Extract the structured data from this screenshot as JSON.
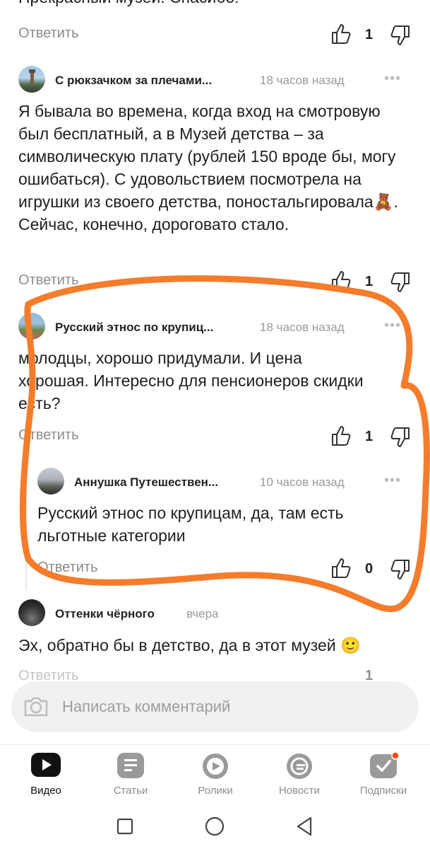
{
  "top_comment": {
    "text_tail": "Прекрасный музей. Спасибо!",
    "reply_label": "Ответить",
    "likes": "1"
  },
  "comments": [
    {
      "author": "С рюкзачком за плечами...",
      "time": "18 часов назад",
      "text": "Я бывала во времена, когда вход на смотровую был бесплатный, а в Музей детства – за символическую плату (рублей 150 вроде бы, могу ошибаться). С удовольствием посмотрела на игрушки из своего детства, поностальгировала🧸. Сейчас, конечно, дороговато стало.",
      "reply_label": "Ответить",
      "likes": "1"
    },
    {
      "author": "Русский этнос по крупиц...",
      "time": "18 часов назад",
      "text": "молодцы, хорошо придумали. И цена хорошая. Интересно для пенсионеров скидки есть?",
      "reply_label": "Ответить",
      "likes": "1"
    },
    {
      "author": "Аннушка Путешествен...",
      "time": "10 часов назад",
      "text": "Русский этнос по крупицам, да, там есть льготные категории",
      "reply_label": "Ответить",
      "likes": "0"
    },
    {
      "author": "Оттенки чёрного",
      "time": "вчера",
      "text": "Эх, обратно бы в детство, да в этот музей 🙂",
      "reply_label": "Ответить",
      "likes": "1"
    }
  ],
  "compose": {
    "placeholder": "Написать комментарий"
  },
  "bottom_nav": {
    "items": [
      {
        "label": "Видео",
        "icon": "video-icon",
        "active": true
      },
      {
        "label": "Статьи",
        "icon": "articles-icon",
        "active": false
      },
      {
        "label": "Ролики",
        "icon": "clips-icon",
        "active": false
      },
      {
        "label": "Новости",
        "icon": "news-icon",
        "active": false
      },
      {
        "label": "Подписки",
        "icon": "subscriptions-icon",
        "active": false,
        "badge": true
      }
    ]
  },
  "colors": {
    "annotation": "#f47c2a",
    "badge": "#ff4d1a"
  }
}
